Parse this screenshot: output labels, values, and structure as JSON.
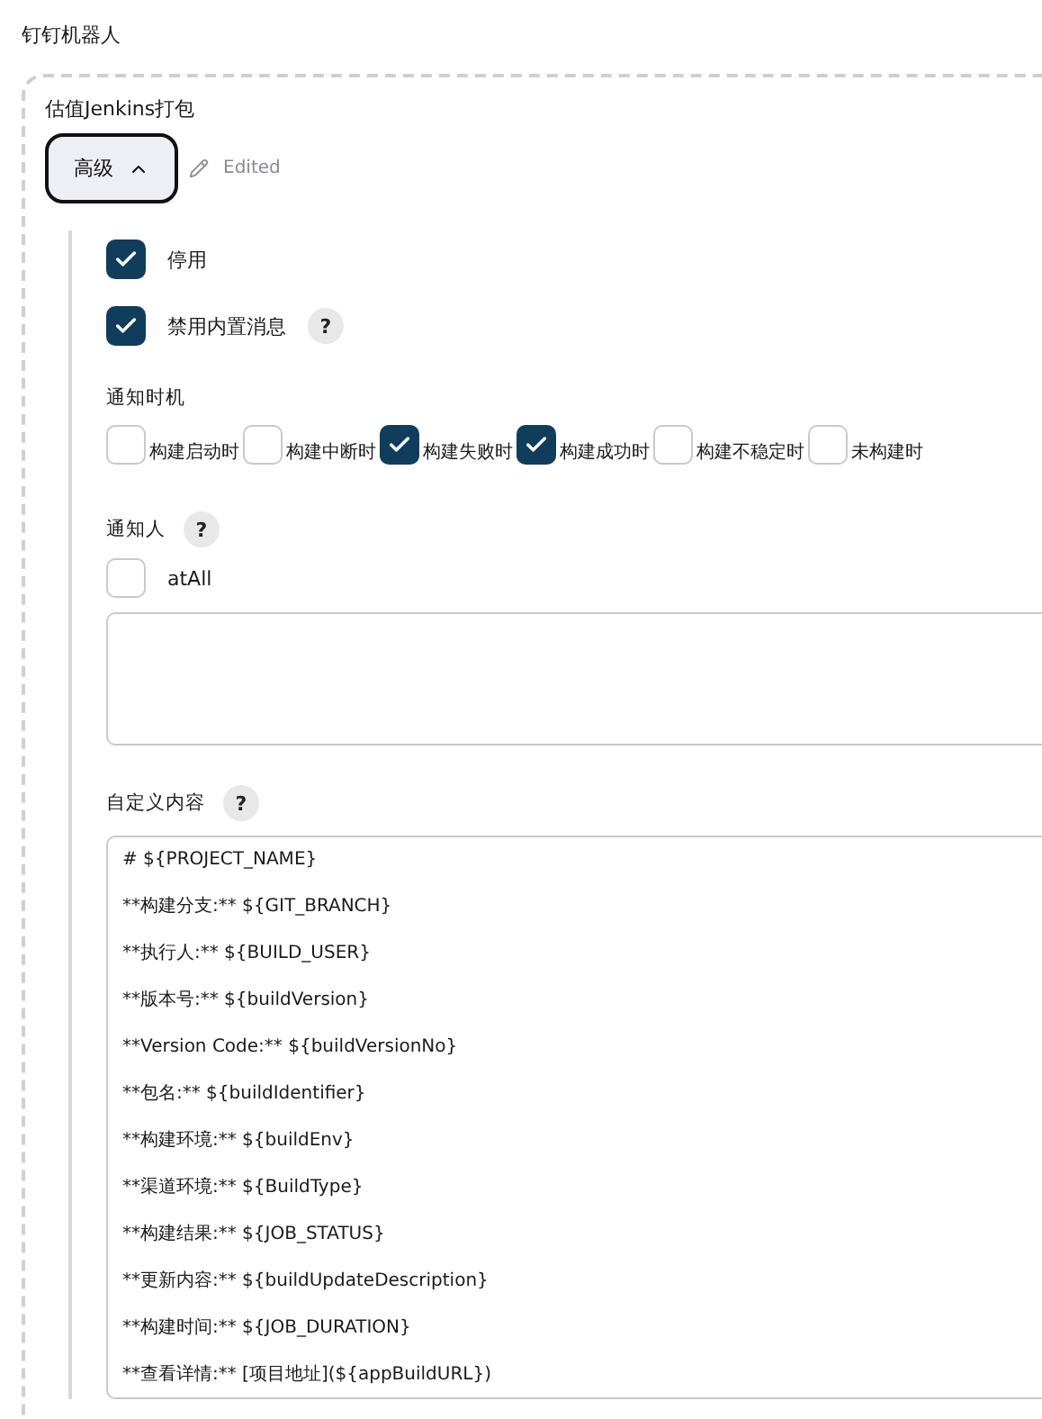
{
  "section_title": "钉钉机器人",
  "robot": {
    "name": "估值Jenkins打包",
    "advanced_button": {
      "label": "高级",
      "expanded": true
    },
    "edited_label": "Edited"
  },
  "options": [
    {
      "label": "停用",
      "checked": true
    },
    {
      "label": "禁用内置消息",
      "checked": true,
      "help": "?"
    }
  ],
  "timing": {
    "label": "通知时机",
    "items": [
      {
        "label": "构建启动时",
        "checked": false
      },
      {
        "label": "构建中断时",
        "checked": false
      },
      {
        "label": "构建失败时",
        "checked": true
      },
      {
        "label": "构建成功时",
        "checked": true
      },
      {
        "label": "构建不稳定时",
        "checked": false
      },
      {
        "label": "未构建时",
        "checked": false
      }
    ]
  },
  "notify": {
    "label": "通知人",
    "help": "?",
    "at_all": {
      "label": "atAll",
      "checked": false
    }
  },
  "custom_content": {
    "label": "自定义内容",
    "help": "?",
    "lines": [
      "# ${PROJECT_NAME}",
      "**构建分支:** ${GIT_BRANCH}",
      "**执行人:** ${BUILD_USER}",
      "**版本号:** ${buildVersion}",
      "**Version Code:** ${buildVersionNo}",
      "**包名:** ${buildIdentifier}",
      "**构建环境:** ${buildEnv}",
      "**渠道环境:** ${BuildType}",
      "**构建结果:** ${JOB_STATUS}",
      "**更新内容:** ${buildUpdateDescription}",
      "**构建时间:** ${JOB_DURATION}",
      "**查看详情:** [项目地址](${appBuildURL})"
    ]
  }
}
